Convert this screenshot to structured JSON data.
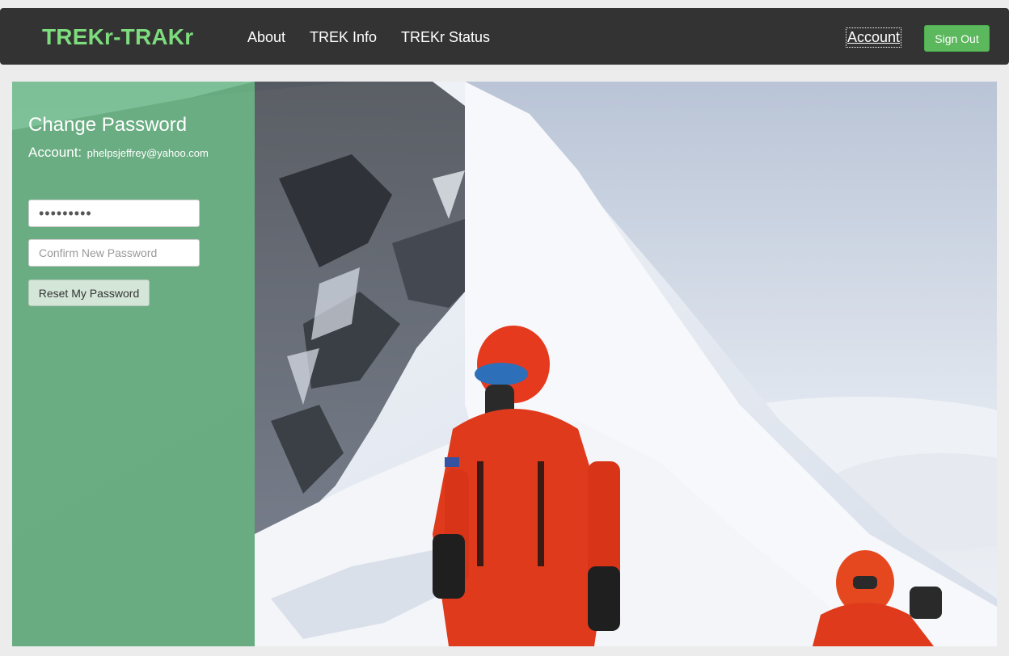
{
  "navbar": {
    "brand": "TREKr-TRAKr",
    "links": [
      "About",
      "TREK Info",
      "TREKr Status"
    ],
    "account_label": "Account",
    "signout_label": "Sign Out"
  },
  "panel": {
    "title": "Change Password",
    "account_label": "Account:",
    "account_email": "phelpsjeffrey@yahoo.com",
    "new_password_value": "•••••••••",
    "confirm_placeholder": "Confirm New Password",
    "reset_label": "Reset My Password"
  },
  "colors": {
    "navbar_bg": "#333333",
    "brand_green": "#7ddc7d",
    "signout_green": "#5cb85c",
    "panel_overlay": "#65be7e"
  },
  "hero_image": {
    "description_icon": "mountain-climbers-photo"
  }
}
